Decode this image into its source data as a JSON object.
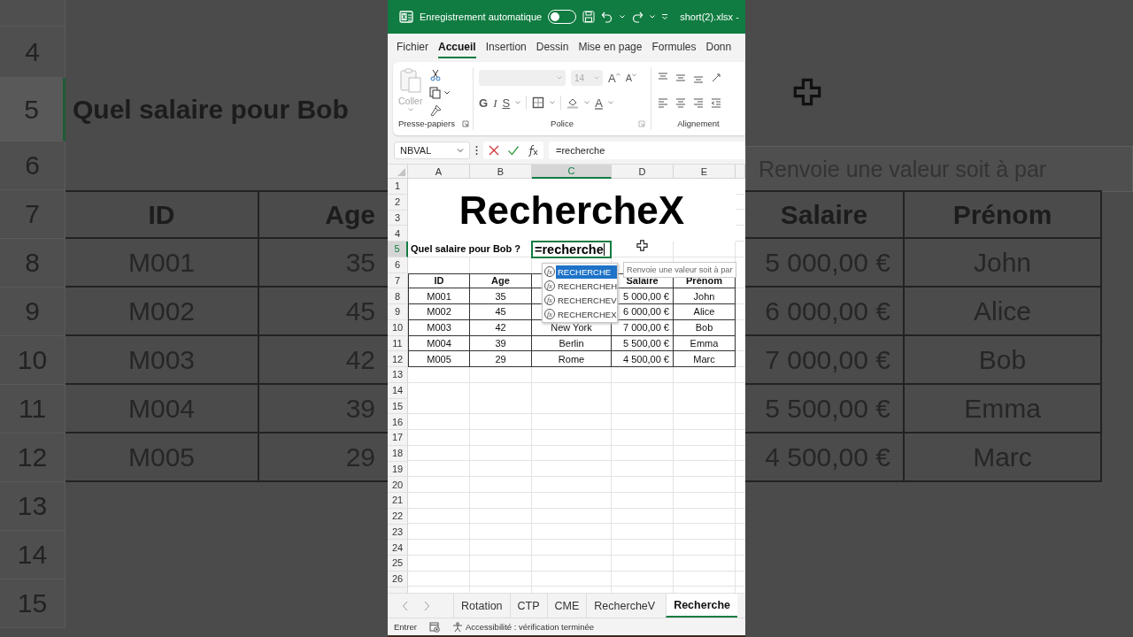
{
  "background_left": {
    "row_numbers": [
      {
        "number": "4",
        "selected": false
      },
      {
        "number": "5",
        "selected": true
      },
      {
        "number": "6",
        "selected": false
      },
      {
        "number": "7",
        "selected": false
      },
      {
        "number": "8",
        "selected": false
      },
      {
        "number": "9",
        "selected": false
      },
      {
        "number": "10",
        "selected": false
      },
      {
        "number": "11",
        "selected": false
      },
      {
        "number": "12",
        "selected": false
      },
      {
        "number": "13",
        "selected": false
      },
      {
        "number": "14",
        "selected": false
      },
      {
        "number": "15",
        "selected": false
      }
    ],
    "question": "Quel salaire pour Bob",
    "headers": [
      "ID",
      "Age"
    ],
    "rows": [
      [
        "M001",
        "35"
      ],
      [
        "M002",
        "45"
      ],
      [
        "M003",
        "42"
      ],
      [
        "M004",
        "39"
      ],
      [
        "M005",
        "29"
      ]
    ]
  },
  "title_bar": {
    "autosave_label": "Enregistrement automatique",
    "autosave_on": false,
    "file_name": "short(2).xlsx -"
  },
  "menu_tabs": [
    {
      "label": "Fichier",
      "selected": false
    },
    {
      "label": "Accueil",
      "selected": true
    },
    {
      "label": "Insertion",
      "selected": false
    },
    {
      "label": "Dessin",
      "selected": false
    },
    {
      "label": "Mise en page",
      "selected": false
    },
    {
      "label": "Formules",
      "selected": false
    },
    {
      "label": "Donn",
      "selected": false
    }
  ],
  "ribbon": {
    "paste_label": "Coller",
    "font_size": "14",
    "grow_font": "A",
    "shrink_font": "A",
    "bold": "G",
    "italic": "I",
    "underline": "S",
    "font_color": "A",
    "groups": [
      "Presse-papiers",
      "Police",
      "Alignement"
    ]
  },
  "formula_bar": {
    "name_box": "NBVAL",
    "formula": "=recherche"
  },
  "sheet": {
    "columns": [
      {
        "label": "A",
        "selected": false
      },
      {
        "label": "B",
        "selected": false
      },
      {
        "label": "C",
        "selected": true
      },
      {
        "label": "D",
        "selected": false
      },
      {
        "label": "E",
        "selected": false
      }
    ],
    "rows": [
      {
        "number": "1",
        "selected": false
      },
      {
        "number": "2",
        "selected": false
      },
      {
        "number": "3",
        "selected": false
      },
      {
        "number": "4",
        "selected": false
      },
      {
        "number": "5",
        "selected": true
      },
      {
        "number": "6",
        "selected": false
      },
      {
        "number": "7",
        "selected": false
      },
      {
        "number": "8",
        "selected": false
      },
      {
        "number": "9",
        "selected": false
      },
      {
        "number": "10",
        "selected": false
      },
      {
        "number": "11",
        "selected": false
      },
      {
        "number": "12",
        "selected": false
      },
      {
        "number": "13",
        "selected": false
      },
      {
        "number": "14",
        "selected": false
      },
      {
        "number": "15",
        "selected": false
      },
      {
        "number": "16",
        "selected": false
      },
      {
        "number": "17",
        "selected": false
      },
      {
        "number": "18",
        "selected": false
      },
      {
        "number": "19",
        "selected": false
      },
      {
        "number": "20",
        "selected": false
      },
      {
        "number": "21",
        "selected": false
      },
      {
        "number": "22",
        "selected": false
      },
      {
        "number": "23",
        "selected": false
      },
      {
        "number": "24",
        "selected": false
      },
      {
        "number": "25",
        "selected": false
      },
      {
        "number": "26",
        "selected": false
      }
    ],
    "title": "RechercheX",
    "question": "Quel salaire pour Bob ?",
    "active_cell": "=recherche",
    "table": {
      "header": [
        {
          "kind": "text",
          "label": "ID"
        },
        {
          "kind": "text",
          "label": "Age"
        },
        {
          "kind": "covered"
        },
        {
          "kind": "text",
          "label": "Salaire"
        },
        {
          "kind": "text",
          "label": "Prénom"
        }
      ],
      "rows": [
        [
          "M001",
          "35",
          null,
          "5 000,00 €",
          "John"
        ],
        [
          "M002",
          "45",
          null,
          "6 000,00 €",
          "Alice"
        ],
        [
          "M003",
          "42",
          "New York",
          "7 000,00 €",
          "Bob"
        ],
        [
          "M004",
          "39",
          "Berlin",
          "5 500,00 €",
          "Emma"
        ],
        [
          "M005",
          "29",
          "Rome",
          "4 500,00 €",
          "Marc"
        ]
      ]
    },
    "autocomplete": [
      {
        "icon": "fx",
        "label": "RECHERCHE",
        "selected": true
      },
      {
        "icon": "fx",
        "label": "RECHERCHEH",
        "selected": false
      },
      {
        "icon": "fx",
        "label": "RECHERCHEV",
        "selected": false
      },
      {
        "icon": "fx",
        "label": "RECHERCHEX",
        "selected": false
      }
    ],
    "tooltip": "Renvoie une valeur soit à par"
  },
  "sheet_tabs": [
    {
      "label": "Rotation",
      "selected": false
    },
    {
      "label": "CTP",
      "selected": false
    },
    {
      "label": "CME",
      "selected": false
    },
    {
      "label": "RechercheV",
      "selected": false
    },
    {
      "label": "Recherche",
      "selected": true
    }
  ],
  "status_bar": {
    "mode": "Entrer",
    "accessibility": "Accessibilité : vérification terminée"
  },
  "background_right": {
    "tooltip": "Renvoie une valeur soit à par",
    "headers": [
      "Salaire",
      "Prénom"
    ],
    "rows": [
      [
        "5 000,00 €",
        "John"
      ],
      [
        "6 000,00 €",
        "Alice"
      ],
      [
        "7 000,00 €",
        "Bob"
      ],
      [
        "5 500,00 €",
        "Emma"
      ],
      [
        "4 500,00 €",
        "Marc"
      ]
    ]
  }
}
